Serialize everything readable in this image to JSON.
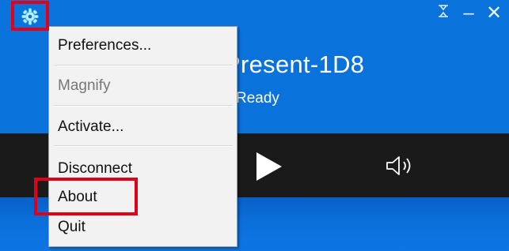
{
  "window": {
    "device_name": "Present-1D8",
    "status": "Ready",
    "controls": {
      "pin_icon": "pin-icon",
      "minimize": "–",
      "close": "✕"
    }
  },
  "menu": {
    "items": [
      {
        "label": "Preferences...",
        "enabled": true
      },
      {
        "label": "Magnify",
        "enabled": false
      },
      {
        "label": "Activate...",
        "enabled": true
      },
      {
        "label": "Disconnect",
        "enabled": true
      },
      {
        "label": "About",
        "enabled": true
      },
      {
        "label": "Quit",
        "enabled": true
      }
    ]
  },
  "playbar": {
    "play_icon": "play-icon",
    "volume_icon": "volume-icon"
  },
  "colors": {
    "accent": "#0a72db",
    "highlight": "#e00018",
    "playbar": "#1a1a1a"
  }
}
